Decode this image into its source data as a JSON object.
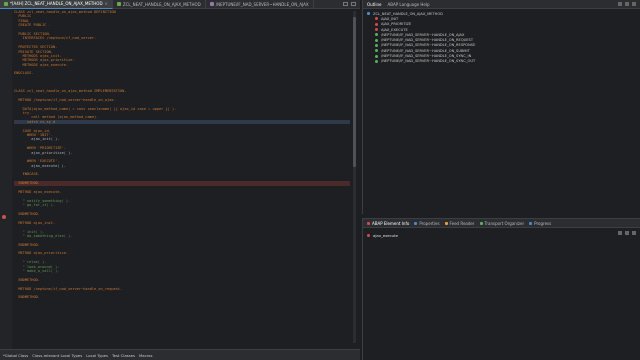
{
  "tabs": [
    {
      "label": "*[A4H] ZCL_NEAT_HANDLE_ON_AJAX_METHOD",
      "active": true
    },
    {
      "label": "ZCL_NEAT_HANDLE_ON_AJAX_METHOD",
      "active": false
    },
    {
      "label": "/NEPTUNE/IF_NAD_SERVER~HANDLE_ON_AJAX",
      "active": false
    }
  ],
  "code_lines": [
    "CLASS zcl_neat_handle_on_ajax_method DEFINITION",
    "  PUBLIC",
    "  FINAL",
    "  CREATE PUBLIC .",
    "",
    "  PUBLIC SECTION.",
    "    INTERFACES /neptune/if_nad_server.",
    "",
    "  PROTECTED SECTION.",
    "  PRIVATE SECTION.",
    "    METHODS ajax_init.",
    "    METHODS ajax_prioritize.",
    "    METHODS ajax_execute.",
    "",
    "ENDCLASS.",
    "",
    "",
    "",
    "CLASS zcl_neat_handle_on_ajax_method IMPLEMENTATION.",
    "",
    "  METHOD /neptune/if_nad_server~handle_on_ajax.",
    "",
    "    DATA(ajax_method_name) = conv seoclsname( |{ ajax_id case = upper }| ).",
    "    try.",
    "        call method (ajax_method_name).",
    "      catch cx_sy_d",
    "",
    "    CASE ajax_id.",
    "      WHEN 'INIT'.",
    "        ajax_init( ).",
    "",
    "      WHEN 'PRIORITIZE'.",
    "        ajax_prioritize( ).",
    "",
    "      WHEN 'EXECUTE'.",
    "        ajax_execute( ).",
    "",
    "    ENDCASE.",
    "",
    "  ENDMETHOD.",
    "",
    "  METHOD ajax_execute.",
    "",
    "    \" notify_something( ).",
    "    \" go_for_it( ).",
    "",
    "  ENDMETHOD.",
    "",
    "  METHOD ajax_init.",
    "",
    "    \" init( ).",
    "    \" do_something_else( ).",
    "",
    "  ENDMETHOD.",
    "",
    "  METHOD ajax_prioritize.",
    "",
    "    \" relax( ).",
    "    \" look_around( ).",
    "    \" make_a_call( ).",
    "",
    "  ENDMETHOD.",
    "",
    "  METHOD /neptune/if_nad_server~handle_on_request.",
    "",
    "  ENDMETHOD."
  ],
  "bottom_tabs": [
    "*Global Class",
    "Class-relevant Local Types",
    "Local Types",
    "Test Classes",
    "Macros"
  ],
  "outline": {
    "tabs": [
      "Outline",
      "ABAP Language Help"
    ],
    "root": "ZCL_NEAT_HANDLE_ON_AJAX_METHOD",
    "items": [
      {
        "label": "AJAX_INIT",
        "kind": "private"
      },
      {
        "label": "AJAX_PRIORITIZE",
        "kind": "private"
      },
      {
        "label": "AJAX_EXECUTE",
        "kind": "private"
      },
      {
        "label": "/NEPTUNE/IF_NAD_SERVER~HANDLE_ON_AJAX",
        "kind": "public"
      },
      {
        "label": "/NEPTUNE/IF_NAD_SERVER~HANDLE_ON_REQUEST",
        "kind": "public"
      },
      {
        "label": "/NEPTUNE/IF_NAD_SERVER~HANDLE_ON_RESPONSE",
        "kind": "public"
      },
      {
        "label": "/NEPTUNE/IF_NAD_SERVER~HANDLE_ON_SUBMIT",
        "kind": "public"
      },
      {
        "label": "/NEPTUNE/IF_NAD_SERVER~HANDLE_ON_SYNC_IN",
        "kind": "public"
      },
      {
        "label": "/NEPTUNE/IF_NAD_SERVER~HANDLE_ON_SYNC_OUT",
        "kind": "public"
      }
    ]
  },
  "element_panel": {
    "tabs": [
      "ABAP Element Info",
      "Properties",
      "Feed Reader",
      "Transport Organizer",
      "Progress"
    ],
    "content": "ajax_execute"
  },
  "colors": {
    "accent": "#4a88c7",
    "keyword": "#cc7832",
    "comment": "#629755",
    "error": "#c75450"
  }
}
